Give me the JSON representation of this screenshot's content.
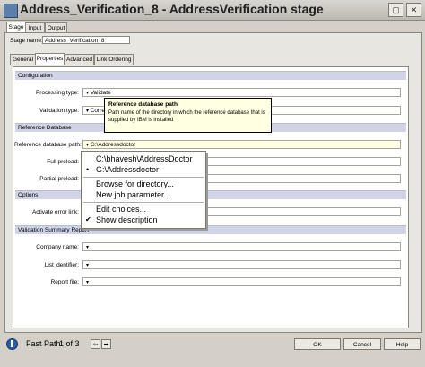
{
  "window": {
    "title": "Address_Verification_8 - AddressVerification stage",
    "minimize_glyph": "▢",
    "close_glyph": "✕"
  },
  "top_tabs": [
    "Stage",
    "Input",
    "Output"
  ],
  "stage_name_label": "Stage name:",
  "stage_name_value": "Address_Verification_8",
  "sub_tabs": [
    "General",
    "Properties",
    "Advanced",
    "Link Ordering"
  ],
  "sections": {
    "configuration": "Configuration",
    "reference_database": "Reference Database",
    "options": "Options",
    "validation_summary": "Validation Summary Report"
  },
  "fields": {
    "processing_type": {
      "label": "Processing type:",
      "value": "Validate"
    },
    "validation_type": {
      "label": "Validation type:",
      "value": "Corre"
    },
    "reference_database_path": {
      "label": "Reference database path:",
      "value": "G:\\Addressdoctor"
    },
    "full_preload": {
      "label": "Full preload:",
      "value": ""
    },
    "partial_preload": {
      "label": "Partial preload:",
      "value": ""
    },
    "activate_error_link": {
      "label": "Activate error link:",
      "value": ""
    },
    "company_name": {
      "label": "Company name:",
      "value": ""
    },
    "list_identifier": {
      "label": "List identifier:",
      "value": ""
    },
    "report_file": {
      "label": "Report file:",
      "value": ""
    }
  },
  "tooltip": {
    "title": "Reference database path",
    "body": "Path name of the directory in which the reference database that is supplied by IBM is installed"
  },
  "menu": {
    "items": [
      {
        "label": "C:\\bhavesh\\AddressDoctor",
        "mark": ""
      },
      {
        "label": "G:\\Addressdoctor",
        "mark": "•"
      },
      {
        "label": "Browse for directory...",
        "mark": ""
      },
      {
        "label": "New job parameter...",
        "mark": ""
      },
      {
        "label": "Edit choices...",
        "mark": ""
      },
      {
        "label": "Show description",
        "mark": "✔"
      }
    ]
  },
  "footer": {
    "fast_path_label": "Fast Path:",
    "fast_path_position": "1 of 3",
    "ok": "OK",
    "cancel": "Cancel",
    "help": "Help"
  },
  "colors": {
    "section_header": "#d0d4e6",
    "tooltip_bg": "#ffffe1",
    "field_highlight": "#ffffe1"
  }
}
